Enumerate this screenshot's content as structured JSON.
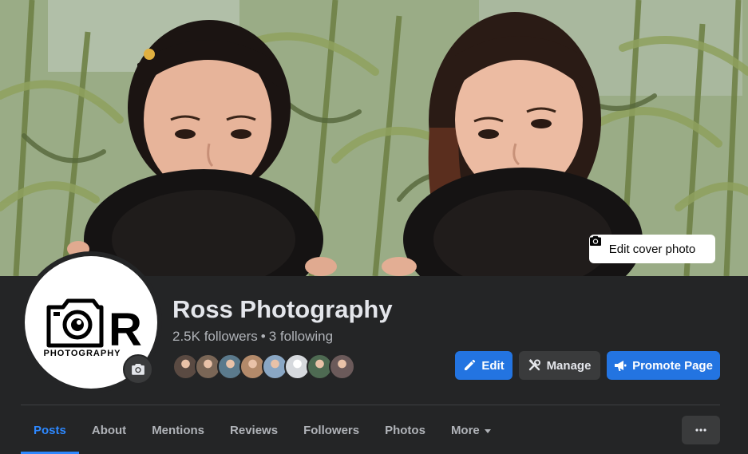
{
  "cover": {
    "edit_cover_label": "Edit cover photo"
  },
  "profile": {
    "name": "Ross Photography",
    "followers": "2.5K followers",
    "separator": "•",
    "following": "3 following",
    "logo_text": "PHOTOGRAPHY",
    "logo_letter": "R"
  },
  "friends": [
    {
      "color": "#5a4a42"
    },
    {
      "color": "#7a6656"
    },
    {
      "color": "#5b7a8c"
    },
    {
      "color": "#b38a6a"
    },
    {
      "color": "#8aa7c4"
    },
    {
      "color": "#d6d9dd"
    },
    {
      "color": "#4e6a52"
    },
    {
      "color": "#6b5a5a"
    }
  ],
  "actions": {
    "edit_label": "Edit",
    "manage_label": "Manage",
    "promote_label": "Promote Page"
  },
  "tabs": [
    {
      "label": "Posts",
      "active": true
    },
    {
      "label": "About"
    },
    {
      "label": "Mentions"
    },
    {
      "label": "Reviews"
    },
    {
      "label": "Followers"
    },
    {
      "label": "Photos"
    },
    {
      "label": "More"
    }
  ],
  "colors": {
    "background": "#242526",
    "accent": "#2374e1",
    "tab_active": "#2d88ff",
    "secondary_button": "#3a3b3c",
    "text_secondary": "#b0b3b8"
  },
  "icons": {
    "edit_cover": "camera-icon",
    "avatar_update": "camera-icon",
    "edit": "pencil-icon",
    "manage": "tools-icon",
    "promote": "megaphone-icon",
    "more_tab": "caret-down-icon",
    "more_options": "ellipsis-icon"
  }
}
